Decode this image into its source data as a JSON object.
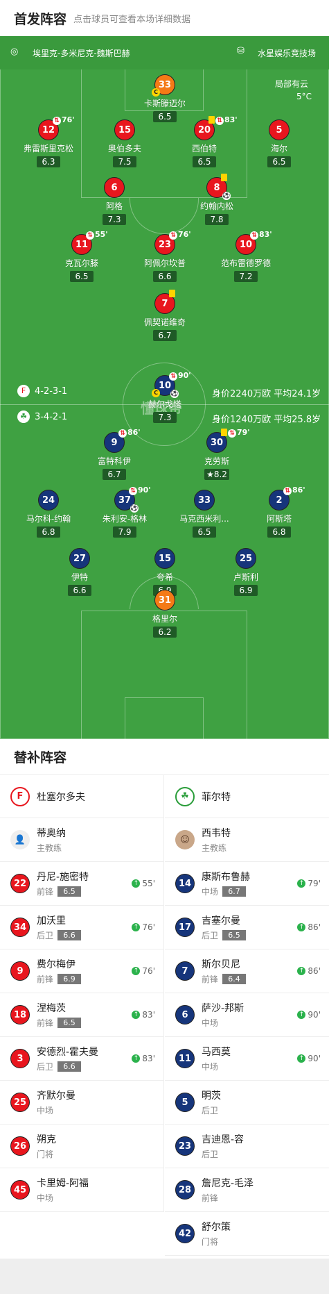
{
  "header": {
    "title": "首发阵容",
    "subtitle": "点击球员可查看本场详细数据"
  },
  "match": {
    "referee": "埃里克-多米尼克-魏斯巴赫",
    "stadium": "水星娱乐竞技场",
    "weather": "局部有云",
    "temp": "5°C",
    "watermark": "懂球帝"
  },
  "home": {
    "formation": "4-2-3-1",
    "value": "身价2240万欧 平均24.1岁",
    "name": "杜塞尔多夫",
    "color": "#e8161e"
  },
  "away": {
    "formation": "3-4-2-1",
    "value": "身价1240万欧 平均25.8岁",
    "name": "菲尔特",
    "color": "#2a9d3a"
  },
  "home_players": [
    {
      "num": "33",
      "name": "卡斯滕迈尔",
      "rating": "6.5",
      "kind": "gk1",
      "cap": true
    },
    {
      "num": "12",
      "name": "弗雷斯里克松",
      "rating": "6.3",
      "sub": "76'"
    },
    {
      "num": "15",
      "name": "奥伯多夫",
      "rating": "7.5"
    },
    {
      "num": "20",
      "name": "西伯特",
      "rating": "6.5",
      "sub": "83'",
      "yc": true
    },
    {
      "num": "5",
      "name": "海尔",
      "rating": "6.5"
    },
    {
      "num": "6",
      "name": "阿格",
      "rating": "7.3"
    },
    {
      "num": "8",
      "name": "约翰内松",
      "rating": "7.8",
      "yc": true,
      "goal": true
    },
    {
      "num": "11",
      "name": "克瓦尔滕",
      "rating": "6.5",
      "sub": "55'"
    },
    {
      "num": "23",
      "name": "阿佩尔坎普",
      "rating": "6.6",
      "sub": "76'"
    },
    {
      "num": "10",
      "name": "范布雷德罗德",
      "rating": "7.2",
      "sub": "83'"
    },
    {
      "num": "7",
      "name": "佩契诺维奇",
      "rating": "6.7",
      "yc": true
    }
  ],
  "away_players": [
    {
      "num": "10",
      "name": "赫尔戈塔",
      "rating": "7.3",
      "sub": "90'",
      "cap": true,
      "goal": true
    },
    {
      "num": "9",
      "name": "富特科伊",
      "rating": "6.7",
      "sub": "86'"
    },
    {
      "num": "30",
      "name": "克劳斯",
      "rating": "8.2",
      "sub": "79'",
      "yc": true,
      "star": true
    },
    {
      "num": "24",
      "name": "马尔科-约翰",
      "rating": "6.8"
    },
    {
      "num": "37",
      "name": "朱利安-格林",
      "rating": "7.9",
      "sub": "90'",
      "goal": true
    },
    {
      "num": "33",
      "name": "马克西米利...",
      "rating": "6.5"
    },
    {
      "num": "2",
      "name": "阿斯塔",
      "rating": "6.8",
      "sub": "86'"
    },
    {
      "num": "27",
      "name": "伊特",
      "rating": "6.6"
    },
    {
      "num": "15",
      "name": "夸希",
      "rating": "6.9"
    },
    {
      "num": "25",
      "name": "卢斯利",
      "rating": "6.9"
    },
    {
      "num": "31",
      "name": "格里尔",
      "rating": "6.2",
      "kind": "gk2"
    }
  ],
  "subs_title": "替补阵容",
  "home_coach": {
    "name": "蒂奥纳",
    "role": "主教练"
  },
  "away_coach": {
    "name": "西韦特",
    "role": "主教练"
  },
  "home_subs": [
    {
      "num": "22",
      "name": "丹尼-施密特",
      "pos": "前锋",
      "rating": "6.5",
      "min": "55'"
    },
    {
      "num": "34",
      "name": "加沃里",
      "pos": "后卫",
      "rating": "6.6",
      "min": "76'"
    },
    {
      "num": "9",
      "name": "费尔梅伊",
      "pos": "前锋",
      "rating": "6.9",
      "min": "76'"
    },
    {
      "num": "18",
      "name": "涅梅茨",
      "pos": "前锋",
      "rating": "6.5",
      "min": "83'"
    },
    {
      "num": "3",
      "name": "安德烈-霍夫曼",
      "pos": "后卫",
      "rating": "6.6",
      "min": "83'"
    },
    {
      "num": "25",
      "name": "齐默尔曼",
      "pos": "中场"
    },
    {
      "num": "26",
      "name": "朔克",
      "pos": "门将"
    },
    {
      "num": "45",
      "name": "卡里姆-阿福",
      "pos": "中场"
    }
  ],
  "away_subs": [
    {
      "num": "14",
      "name": "康斯布鲁赫",
      "pos": "中场",
      "rating": "6.7",
      "min": "79'"
    },
    {
      "num": "17",
      "name": "吉塞尔曼",
      "pos": "后卫",
      "rating": "6.5",
      "min": "86'"
    },
    {
      "num": "7",
      "name": "斯尔贝尼",
      "pos": "前锋",
      "rating": "6.4",
      "min": "86'"
    },
    {
      "num": "6",
      "name": "萨沙-邦斯",
      "pos": "中场",
      "min": "90'"
    },
    {
      "num": "11",
      "name": "马西莫",
      "pos": "中场",
      "min": "90'"
    },
    {
      "num": "5",
      "name": "明茨",
      "pos": "后卫"
    },
    {
      "num": "23",
      "name": "吉迪恩-容",
      "pos": "后卫"
    },
    {
      "num": "28",
      "name": "詹尼克-毛泽",
      "pos": "前锋"
    },
    {
      "num": "42",
      "name": "舒尔策",
      "pos": "门将"
    }
  ]
}
